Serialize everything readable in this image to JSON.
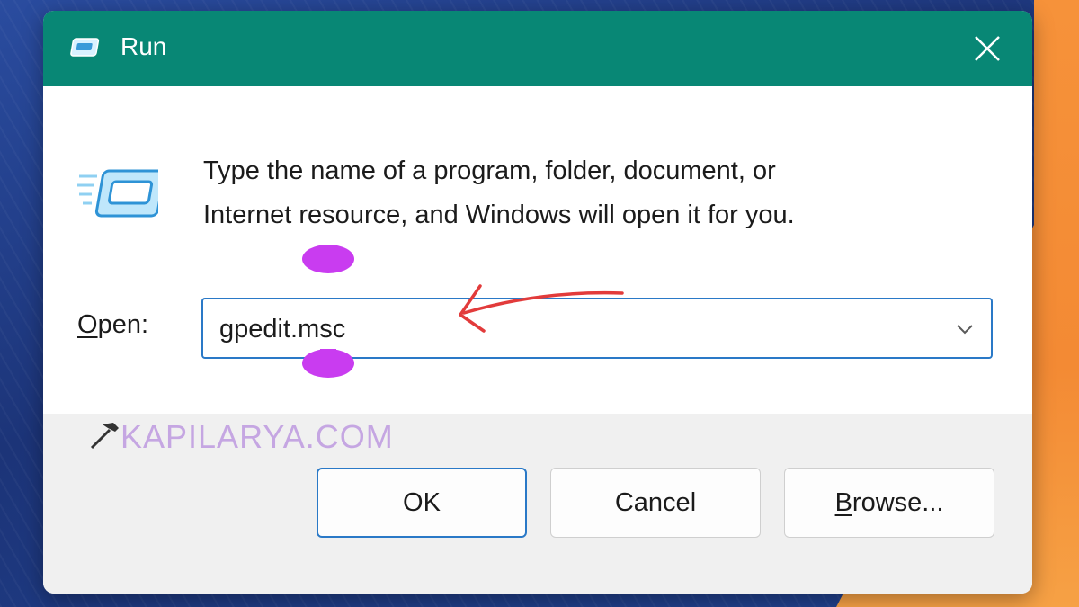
{
  "window": {
    "title": "Run",
    "close_icon": "close-icon"
  },
  "dialog": {
    "description_line1": "Type the name of a program, folder, document, or",
    "description_line2": "Internet resource, and Windows will open it for you.",
    "open_label_accel": "O",
    "open_label_rest": "pen:",
    "open_value": "gpedit.msc"
  },
  "buttons": {
    "ok": "OK",
    "cancel": "Cancel",
    "browse_accel": "B",
    "browse_rest": "rowse..."
  },
  "watermark": {
    "text": "KAPILARYA.COM"
  },
  "colors": {
    "titlebar": "#088775",
    "accent_border": "#2a79c7",
    "annotation_magenta": "#c93cf0",
    "annotation_arrow": "#e23b3b",
    "background_orange": "#f38a34",
    "background_blue": "#1c3478"
  }
}
